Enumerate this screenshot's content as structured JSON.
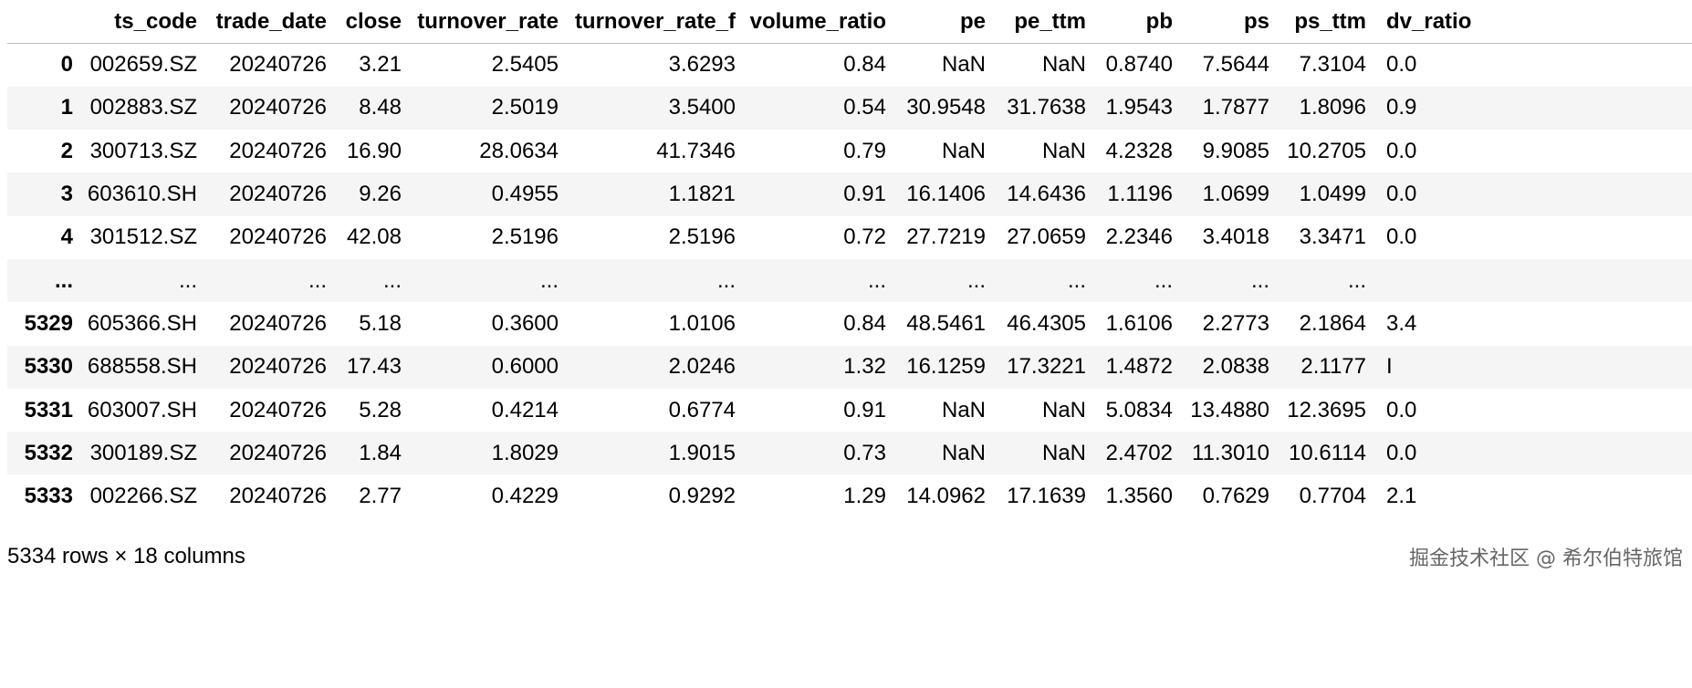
{
  "table": {
    "columns": [
      "ts_code",
      "trade_date",
      "close",
      "turnover_rate",
      "turnover_rate_f",
      "volume_ratio",
      "pe",
      "pe_ttm",
      "pb",
      "ps",
      "ps_ttm",
      "dv_ratio"
    ],
    "index": [
      "0",
      "1",
      "2",
      "3",
      "4",
      "...",
      "5329",
      "5330",
      "5331",
      "5332",
      "5333"
    ],
    "rows": [
      [
        "002659.SZ",
        "20240726",
        "3.21",
        "2.5405",
        "3.6293",
        "0.84",
        "NaN",
        "NaN",
        "0.8740",
        "7.5644",
        "7.3104",
        "0.0"
      ],
      [
        "002883.SZ",
        "20240726",
        "8.48",
        "2.5019",
        "3.5400",
        "0.54",
        "30.9548",
        "31.7638",
        "1.9543",
        "1.7877",
        "1.8096",
        "0.9"
      ],
      [
        "300713.SZ",
        "20240726",
        "16.90",
        "28.0634",
        "41.7346",
        "0.79",
        "NaN",
        "NaN",
        "4.2328",
        "9.9085",
        "10.2705",
        "0.0"
      ],
      [
        "603610.SH",
        "20240726",
        "9.26",
        "0.4955",
        "1.1821",
        "0.91",
        "16.1406",
        "14.6436",
        "1.1196",
        "1.0699",
        "1.0499",
        "0.0"
      ],
      [
        "301512.SZ",
        "20240726",
        "42.08",
        "2.5196",
        "2.5196",
        "0.72",
        "27.7219",
        "27.0659",
        "2.2346",
        "3.4018",
        "3.3471",
        "0.0"
      ],
      [
        "...",
        "...",
        "...",
        "...",
        "...",
        "...",
        "...",
        "...",
        "...",
        "...",
        "...",
        ""
      ],
      [
        "605366.SH",
        "20240726",
        "5.18",
        "0.3600",
        "1.0106",
        "0.84",
        "48.5461",
        "46.4305",
        "1.6106",
        "2.2773",
        "2.1864",
        "3.4"
      ],
      [
        "688558.SH",
        "20240726",
        "17.43",
        "0.6000",
        "2.0246",
        "1.32",
        "16.1259",
        "17.3221",
        "1.4872",
        "2.0838",
        "2.1177",
        "I"
      ],
      [
        "603007.SH",
        "20240726",
        "5.28",
        "0.4214",
        "0.6774",
        "0.91",
        "NaN",
        "NaN",
        "5.0834",
        "13.4880",
        "12.3695",
        "0.0"
      ],
      [
        "300189.SZ",
        "20240726",
        "1.84",
        "1.8029",
        "1.9015",
        "0.73",
        "NaN",
        "NaN",
        "2.4702",
        "11.3010",
        "10.6114",
        "0.0"
      ],
      [
        "002266.SZ",
        "20240726",
        "2.77",
        "0.4229",
        "0.9292",
        "1.29",
        "14.0962",
        "17.1639",
        "1.3560",
        "0.7629",
        "0.7704",
        "2.1"
      ]
    ]
  },
  "footer": "5334 rows × 18 columns",
  "watermark": "掘金技术社区 @ 希尔伯特旅馆"
}
